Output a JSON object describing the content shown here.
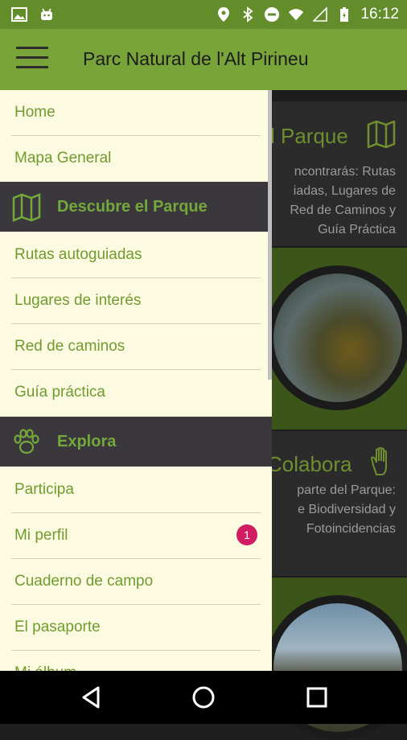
{
  "status_bar": {
    "time": "16:12",
    "left_icons": [
      "image-icon",
      "android-icon"
    ],
    "right_icons": [
      "location-icon",
      "bluetooth-icon",
      "do-not-disturb-icon",
      "wifi-icon",
      "signal-icon",
      "battery-icon"
    ]
  },
  "app_bar": {
    "title": "Parc Natural de l'Alt Pirineu",
    "menu_icon": "hamburger-menu-icon"
  },
  "drawer": {
    "items_top": [
      {
        "label": "Home"
      },
      {
        "label": "Mapa General"
      }
    ],
    "section_discover": {
      "label": "Descubre el Parque",
      "icon": "map-icon"
    },
    "items_discover": [
      {
        "label": "Rutas autoguiadas"
      },
      {
        "label": "Lugares de interés"
      },
      {
        "label": "Red de caminos"
      },
      {
        "label": "Guía práctica"
      }
    ],
    "section_explore": {
      "label": "Explora",
      "icon": "paw-icon"
    },
    "items_explore": [
      {
        "label": "Participa"
      },
      {
        "label": "Mi perfil",
        "badge": "1"
      },
      {
        "label": "Cuaderno de campo"
      },
      {
        "label": "El pasaporte"
      },
      {
        "label": "Mi álbum"
      }
    ]
  },
  "background": {
    "card1": {
      "title": "l Parque",
      "text_lines": [
        "ncontrarás: Rutas",
        "iadas, Lugares de",
        "Red de Caminos y",
        "Guía Práctica"
      ]
    },
    "card2": {
      "title": "Colabora",
      "text_lines": [
        "parte del Parque:",
        "e Biodiversidad y",
        "Fotoincidencias"
      ]
    }
  },
  "colors": {
    "accent_green": "#78a43a",
    "status_green": "#628d2a",
    "drawer_bg": "#fdfae2",
    "section_bg": "#3a373d",
    "badge": "#d21c61"
  }
}
